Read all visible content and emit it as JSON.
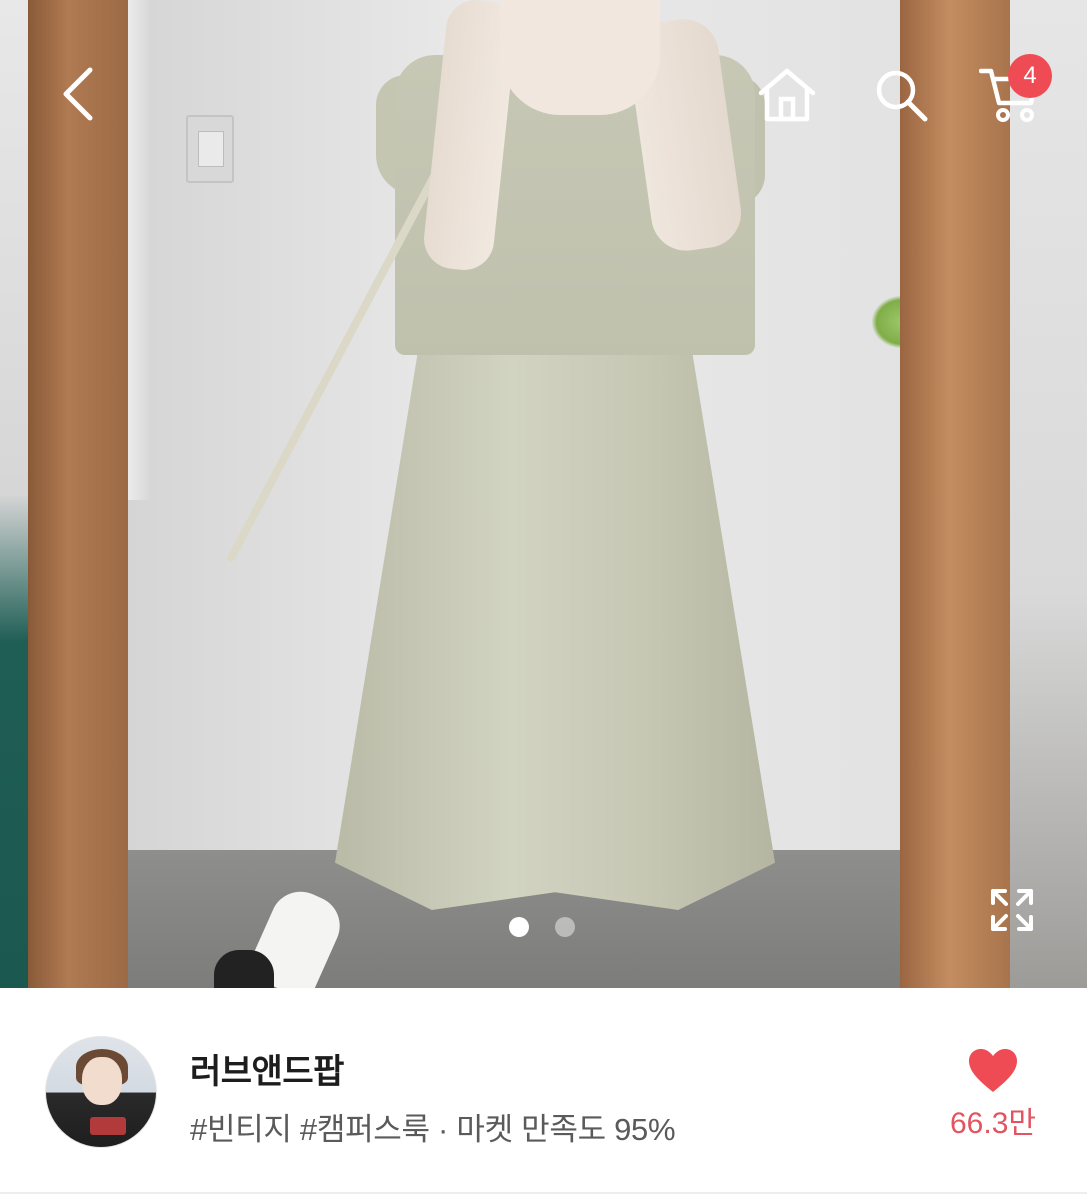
{
  "header": {
    "back_icon": "chevron-left-icon",
    "home_icon": "home-icon",
    "search_icon": "search-icon",
    "cart_icon": "cart-icon",
    "cart_count": "4"
  },
  "gallery": {
    "total_images": 2,
    "active_index": 0,
    "expand_icon": "expand-icon"
  },
  "shop": {
    "name": "러브앤드팝",
    "tags_line": "#빈티지 #캠퍼스룩 · 마켓 만족도 95%",
    "like_icon": "heart-icon",
    "like_count": "66.3만"
  },
  "colors": {
    "accent_red": "#ef4b55",
    "like_text": "#e25560",
    "name_text": "#1d1d1d",
    "tag_text": "#5a5a5a"
  }
}
